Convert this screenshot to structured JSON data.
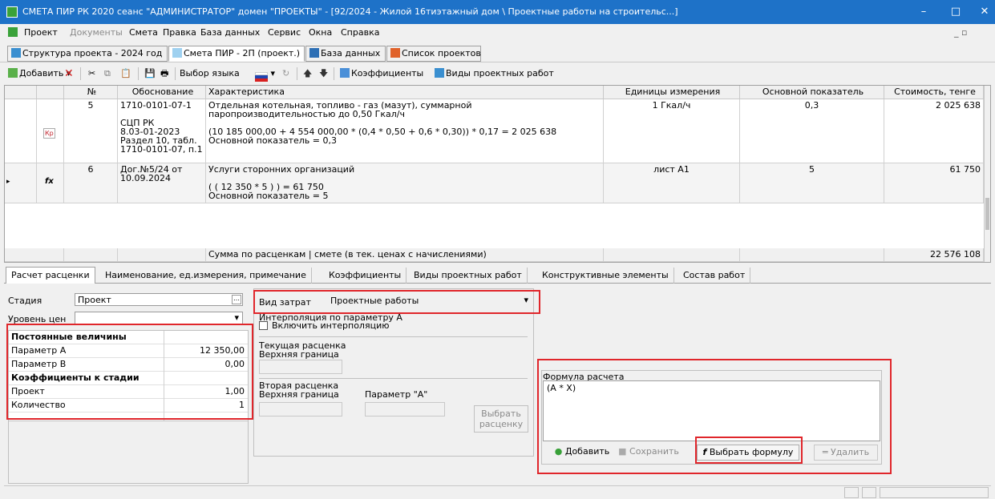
{
  "window": {
    "title": "СМЕТА ПИР РК 2020 сеанс \"АДМИНИСТРАТОР\" домен \"ПРОЕКТЫ\" - [92/2024 - Жилой 16тиэтажный дом \\ Проектные работы на строительс...]",
    "minimize": "–",
    "maximize": "□",
    "close": "✕"
  },
  "menu": [
    "Проект",
    "Документы",
    "Смета",
    "Правка",
    "База данных",
    "Сервис",
    "Окна",
    "Справка"
  ],
  "doc_tabs": [
    "Структура проекта - 2024 год",
    "Смета ПИР - 2П (проект.)",
    "База данных",
    "Список проектов"
  ],
  "toolbar": {
    "add": "Добавить",
    "lang": "Выбор языка",
    "coeffs": "Коэффициенты",
    "work_types": "Виды проектных работ"
  },
  "grid": {
    "headers": [
      "№",
      "Обоснование",
      "Характеристика",
      "Единицы измерения",
      "Основной показатель",
      "Стоимость, тенге"
    ],
    "rows": [
      {
        "num": "5",
        "basis": [
          "1710-0101-07-1",
          "",
          "СЦП РК",
          "8.03-01-2023",
          "Раздел 10, табл.",
          "1710-0101-07, п.1"
        ],
        "desc": [
          "Отдельная котельная, топливо - газ (мазут), суммарной",
          "паропроизводительностью  до 0,50 Гкал/ч",
          "",
          "(10 185 000,00 + 4 554 000,00 * (0,4 * 0,50 + 0,6 * 0,30)) * 0,17  = 2 025 638",
          "Основной показатель = 0,3"
        ],
        "unit": "1 Гкал/ч",
        "main": "0,3",
        "cost": "2 025 638",
        "icon": "Кр"
      },
      {
        "num": "6",
        "basis": [
          "Дог.№5/24 от",
          "10.09.2024"
        ],
        "desc": [
          "Услуги сторонних организаций",
          "",
          "( ( 12 350 * 5 ) )  = 61 750",
          "Основной показатель = 5"
        ],
        "unit": "лист А1",
        "main": "5",
        "cost": "61 750",
        "icon": "fx"
      }
    ],
    "footer_label": "Сумма по расценкам | смете (в тек. ценах с начислениями)",
    "footer_total": "22 576 108"
  },
  "bottom_tabs": [
    "Расчет расценки",
    "Наименование, ед.измерения, примечание",
    "Коэффициенты",
    "Виды проектных работ",
    "Конструктивные элементы",
    "Состав работ"
  ],
  "detail": {
    "stage_label": "Стадия",
    "stage_value": "Проект",
    "price_level_label": "Уровень цен",
    "const_header": "Постоянные величины",
    "param_a_label": "Параметр A",
    "param_a_value": "12 350,00",
    "param_b_label": "Параметр B",
    "param_b_value": "0,00",
    "coef_header": "Коэффициенты к стадии",
    "project_label": "Проект",
    "project_value": "1,00",
    "qty_label": "Количество",
    "qty_value": "1",
    "cost_type_label": "Вид затрат",
    "cost_type_value": "Проектные работы",
    "interp_header": "Интерполяция по параметру А",
    "interp_checkbox": "Включить интерполяцию",
    "cur_rate": "Текущая расценка",
    "upper1": "Верхняя граница",
    "second_rate": "Вторая расценка",
    "upper2": "Верхняя граница",
    "param_a_quoted": "Параметр \"А\"",
    "choose_rate": [
      "Выбрать",
      "расценку"
    ],
    "formula_label": "Формула расчета",
    "formula_value": "(A * X)",
    "btn_add": "Добавить",
    "btn_save": "Сохранить",
    "btn_choose_formula": "Выбрать формулу",
    "btn_delete": "Удалить"
  }
}
